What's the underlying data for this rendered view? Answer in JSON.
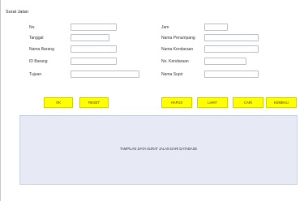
{
  "window": {
    "title": "Surat Jalan"
  },
  "form": {
    "left": [
      {
        "label": "No.",
        "value": ""
      },
      {
        "label": "Tanggal",
        "value": ""
      },
      {
        "label": "Nama Barang",
        "value": ""
      },
      {
        "label": "ID Barang",
        "value": ""
      },
      {
        "label": "Tujuan",
        "value": ""
      }
    ],
    "right": [
      {
        "label": "Jam",
        "value": ""
      },
      {
        "label": "Nama Penumpang",
        "value": ""
      },
      {
        "label": "Nama Kendaraan",
        "value": ""
      },
      {
        "label": "No. Kendaraan",
        "value": ""
      },
      {
        "label": "Nama Supir",
        "value": ""
      }
    ]
  },
  "buttons": {
    "ok": "OK",
    "reset": "RESET",
    "hapus": "HAPUS",
    "lihat": "LIHAT",
    "cari": "CARI",
    "kembali": "KEMBALI"
  },
  "panel": {
    "text": "TAMPILAN DATA SURAT JALAN DARI DATABASE"
  },
  "colors": {
    "button": "#ffff00",
    "panel": "#e7eaf4"
  }
}
